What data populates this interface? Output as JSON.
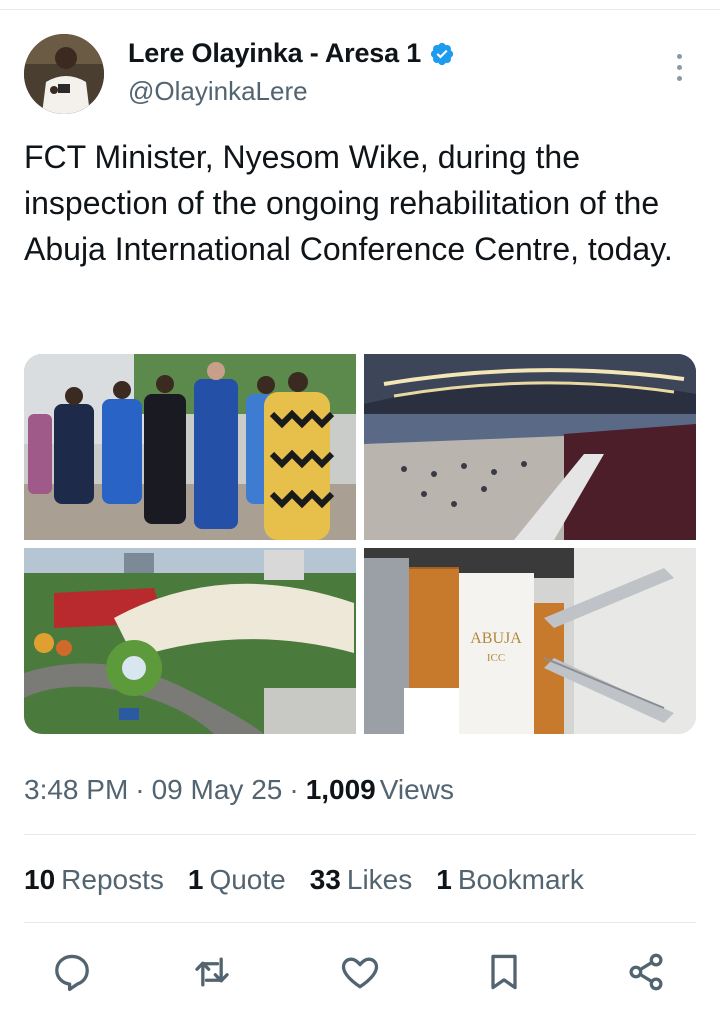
{
  "author": {
    "display_name": "Lere Olayinka - Aresa 1",
    "handle": "@OlayinkaLere"
  },
  "icons": {
    "verified": "verified-badge-icon",
    "more": "more-vertical-icon",
    "reply": "reply-icon",
    "retweet": "retweet-icon",
    "like": "heart-icon",
    "bookmark": "bookmark-icon",
    "share": "share-icon"
  },
  "tweet": {
    "text": "FCT Minister,  Nyesom Wike,  during the inspection of the ongoing rehabilitation of the Abuja International Conference Centre, today."
  },
  "media": {
    "sign_line1": "ABUJA",
    "sign_line2": "ICC"
  },
  "meta": {
    "time": "3:48 PM",
    "sep1": "·",
    "date": "09 May 25",
    "sep2": "·",
    "views_count": "1,009",
    "views_label": "Views"
  },
  "stats": {
    "reposts_count": "10",
    "reposts_label": "Reposts",
    "quotes_count": "1",
    "quotes_label": "Quote",
    "likes_count": "33",
    "likes_label": "Likes",
    "bookmarks_count": "1",
    "bookmarks_label": "Bookmark"
  },
  "colors": {
    "verified": "#1d9bf0",
    "text": "#0f1419",
    "secondary": "#536471",
    "icon": "#536471"
  }
}
